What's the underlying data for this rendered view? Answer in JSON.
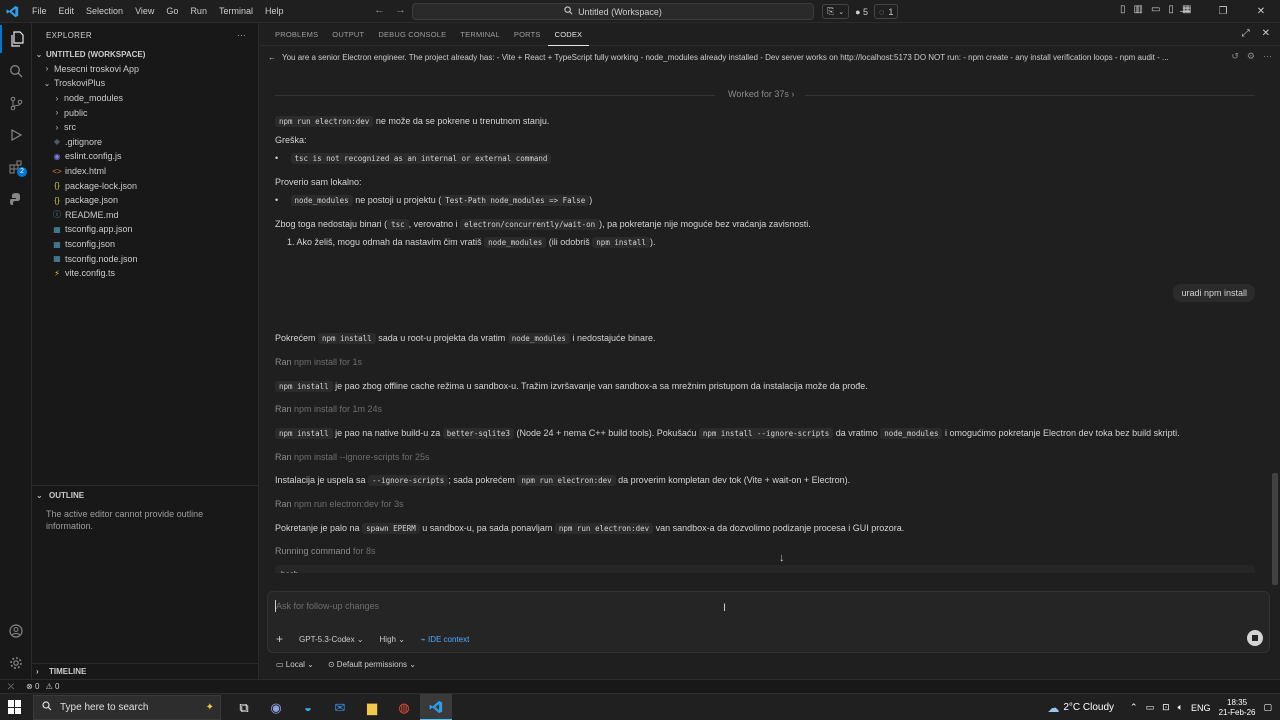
{
  "titlebar": {
    "menu": [
      "File",
      "Edit",
      "Selection",
      "View",
      "Go",
      "Run",
      "Terminal",
      "Help"
    ],
    "search_text": "Untitled (Workspace)",
    "badge_count_1": "5",
    "badge_count_2": "1"
  },
  "explorer": {
    "title": "EXPLORER",
    "workspace": "UNTITLED (WORKSPACE)",
    "items": [
      {
        "label": "Mesecni troskovi App",
        "kind": "folder",
        "depth": 1,
        "open": false
      },
      {
        "label": "TroskoviPlus",
        "kind": "folder",
        "depth": 1,
        "open": true
      },
      {
        "label": "node_modules",
        "kind": "folder",
        "depth": 2,
        "open": false
      },
      {
        "label": "public",
        "kind": "folder",
        "depth": 2,
        "open": false
      },
      {
        "label": "src",
        "kind": "folder",
        "depth": 2,
        "open": false
      },
      {
        "label": ".gitignore",
        "kind": "git",
        "depth": 2
      },
      {
        "label": "eslint.config.js",
        "kind": "eslint",
        "depth": 2
      },
      {
        "label": "index.html",
        "kind": "html",
        "depth": 2
      },
      {
        "label": "package-lock.json",
        "kind": "json",
        "depth": 2
      },
      {
        "label": "package.json",
        "kind": "json",
        "depth": 2
      },
      {
        "label": "README.md",
        "kind": "info",
        "depth": 2
      },
      {
        "label": "tsconfig.app.json",
        "kind": "ts",
        "depth": 2
      },
      {
        "label": "tsconfig.json",
        "kind": "ts",
        "depth": 2
      },
      {
        "label": "tsconfig.node.json",
        "kind": "ts",
        "depth": 2
      },
      {
        "label": "vite.config.ts",
        "kind": "vite",
        "depth": 2
      }
    ],
    "outline_title": "OUTLINE",
    "outline_text": "The active editor cannot provide outline information.",
    "timeline_title": "TIMELINE"
  },
  "panel": {
    "tabs": [
      "PROBLEMS",
      "OUTPUT",
      "DEBUG CONSOLE",
      "TERMINAL",
      "PORTS",
      "CODEX"
    ],
    "active_tab": "CODEX",
    "prompt": "You are a senior Electron engineer. The project already has: - Vite + React + TypeScript fully working - node_modules already installed - Dev server works on http://localhost:5173 DO NOT run: - npm create - any install verification loops - npm audit - ..."
  },
  "chat": {
    "worked": "Worked for 37s",
    "m1_code": "npm run electron:dev",
    "m1_text": " ne može da se pokrene u trenutnom stanju.",
    "m2": "Greška:",
    "m3_code": "tsc is not recognized as an internal or external command",
    "m4": "Proverio sam lokalno:",
    "m5_code": "node_modules",
    "m5_text": " ne postoji u projektu (",
    "m5_code2": "Test-Path node_modules => False",
    "m5_end": ")",
    "m6_a": "Zbog toga nedostaju binari (",
    "m6_code1": "tsc",
    "m6_b": ", verovatno i ",
    "m6_code2": "electron/concurrently/wait-on",
    "m6_c": "), pa pokretanje nije moguće bez vraćanja zavisnosti.",
    "m7_a": "1. Ako želiš, mogu odmah da nastavim čim vratiš ",
    "m7_code1": "node_modules",
    "m7_b": " (ili odobriš ",
    "m7_code2": "npm install",
    "m7_c": ").",
    "user": "uradi npm install",
    "m8_a": "Pokrećem ",
    "m8_code1": "npm install",
    "m8_b": " sada u root-u projekta da vratim ",
    "m8_code2": "node_modules",
    "m8_c": " i nedostajuće binare.",
    "ran1_a": "Ran ",
    "ran1_b": "npm install for 1s",
    "m9_code": "npm install",
    "m9_text": " je pao zbog offline cache režima u sandbox-u. Tražim izvršavanje van sandbox-a sa mrežnim pristupom da instalacija može da prođe.",
    "ran2_a": "Ran ",
    "ran2_b": "npm install for 1m 24s",
    "m10_code1": "npm install",
    "m10_a": " je pao na native build-u za ",
    "m10_code2": "better-sqlite3",
    "m10_b": " (Node 24 + nema C++ build tools). Pokušaću ",
    "m10_code3": "npm install --ignore-scripts",
    "m10_c": " da vratimo ",
    "m10_code4": "node_modules",
    "m10_d": " i omogućimo pokretanje Electron dev toka bez build skripti.",
    "ran3_a": "Ran ",
    "ran3_b": "npm install --ignore-scripts for 25s",
    "m11_a": "Instalacija je uspela sa ",
    "m11_code1": "--ignore-scripts",
    "m11_b": "; sada pokrećem ",
    "m11_code2": "npm run electron:dev",
    "m11_c": " da proverim kompletan dev tok (Vite + wait-on + Electron).",
    "ran4_a": "Ran ",
    "ran4_b": "npm run electron:dev for 3s",
    "m12_a": "Pokretanje je palo na ",
    "m12_code1": "spawn EPERM",
    "m12_b": " u sandbox-u, pa sada ponavljam ",
    "m12_code2": "npm run electron:dev",
    "m12_c": " van sandbox-a da dozvolimo podizanje procesa i GUI prozora.",
    "running_a": "Running command ",
    "running_b": "for 8s",
    "bash": "bash"
  },
  "composer": {
    "placeholder": "Ask for follow-up changes",
    "model": "GPT-5.3-Codex",
    "effort": "High",
    "context": "IDE context",
    "local": "Local",
    "permissions": "Default permissions"
  },
  "statusbar": {
    "errors": "0",
    "warnings": "0"
  },
  "taskbar": {
    "search_placeholder": "Type here to search",
    "weather": "2°C  Cloudy",
    "lang": "ENG",
    "time": "18:35",
    "date": "21-Feb-26"
  }
}
